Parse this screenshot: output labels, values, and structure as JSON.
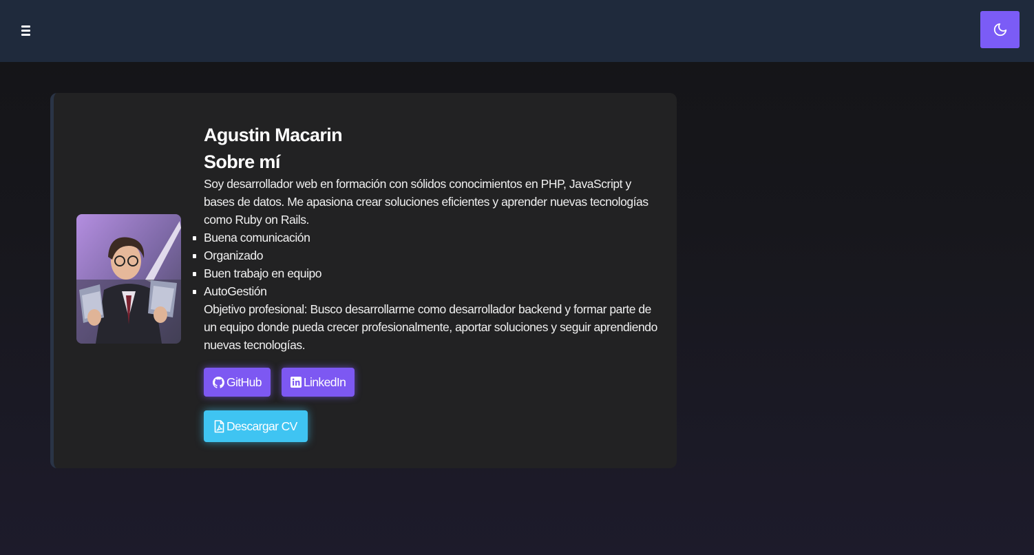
{
  "header": {
    "menu_icon": "hamburger-icon",
    "theme_toggle_icon": "moon-icon"
  },
  "profile": {
    "name": "Agustin Macarin",
    "about_title": "Sobre mí",
    "intro": "Soy desarrollador web en formación con sólidos conocimientos en PHP, JavaScript y bases de datos. Me apasiona crear soluciones eficientes y aprender nuevas tecnologías como Ruby on Rails.",
    "skills": [
      "Buena comunicación",
      "Organizado",
      "Buen trabajo en equipo",
      "AutoGestión"
    ],
    "objective": "Objetivo profesional: Busco desarrollarme como desarrollador backend y formar parte de un equipo donde pueda crecer profesionalmente, aportar soluciones y seguir aprendiendo nuevas tecnologías."
  },
  "buttons": {
    "github_label": "GitHub",
    "github_icon": "github-icon",
    "linkedin_label": "LinkedIn",
    "linkedin_icon": "linkedin-icon",
    "cv_label": "Descargar CV",
    "cv_icon": "pdf-file-icon"
  },
  "colors": {
    "header_bg": "#1f2a3c",
    "accent_purple": "#7b5cf6",
    "accent_cyan": "#3fc4f2",
    "card_bg": "#222223"
  }
}
